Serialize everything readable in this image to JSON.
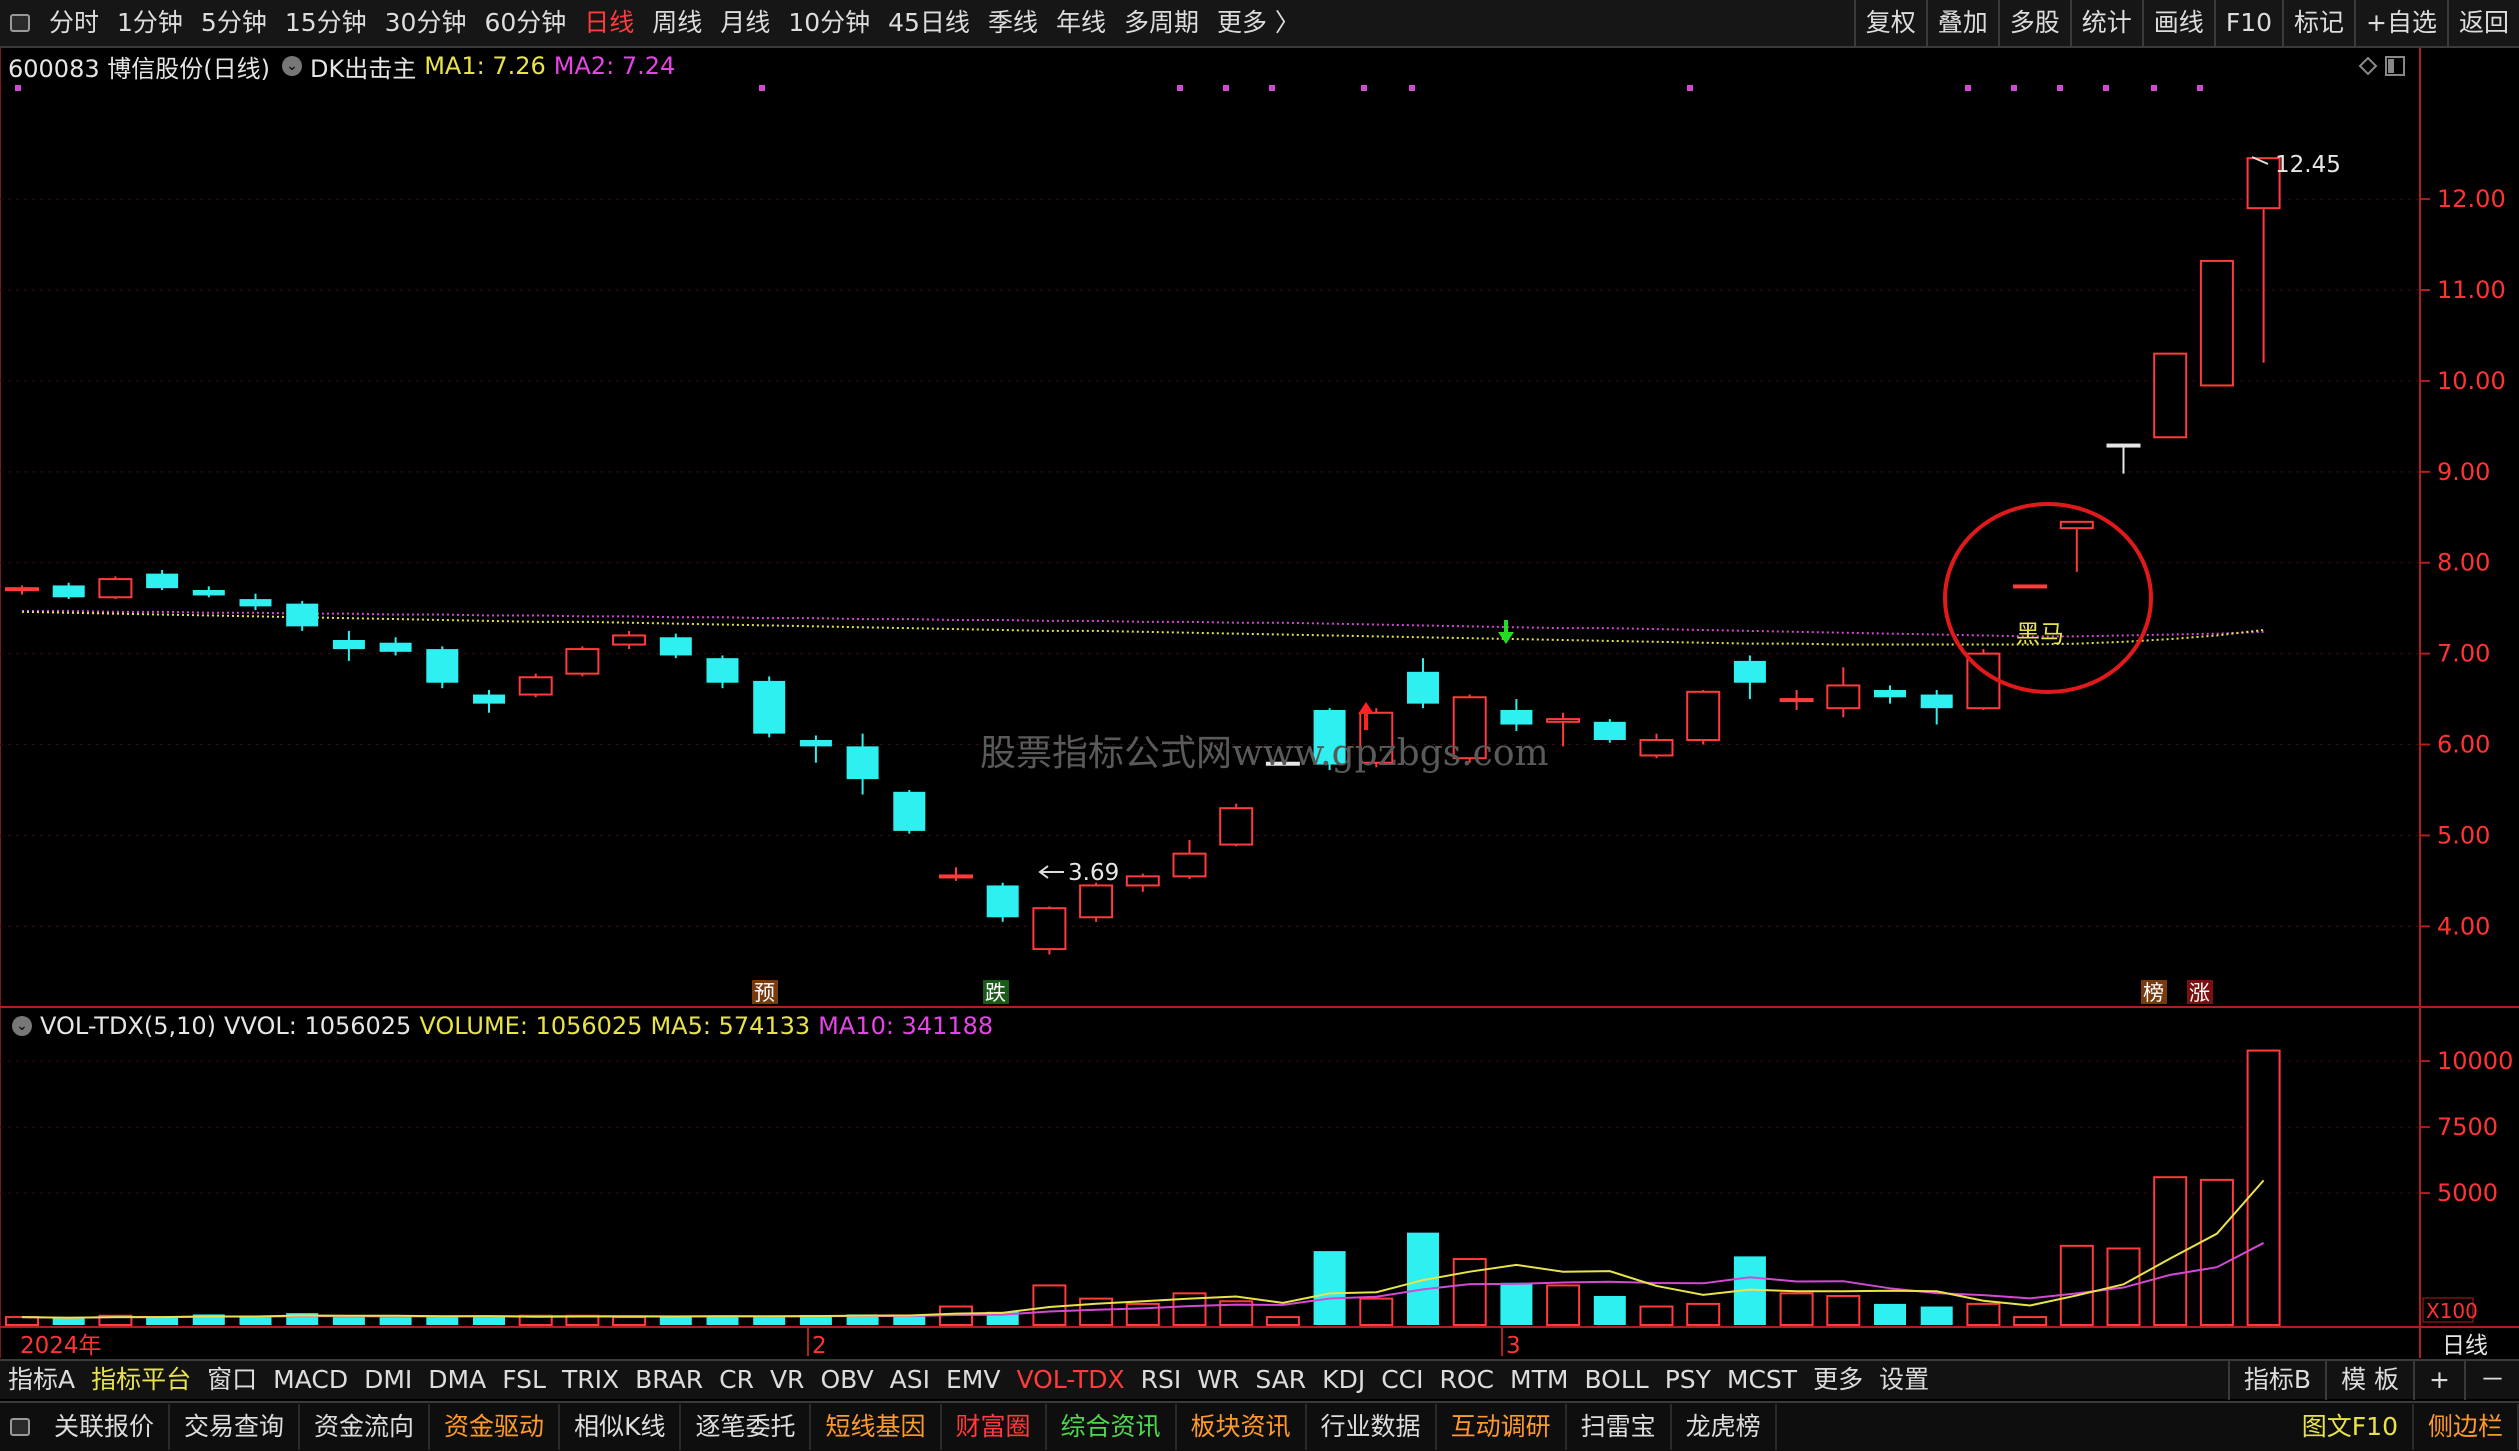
{
  "topbar": {
    "timeframes": [
      "分时",
      "1分钟",
      "5分钟",
      "15分钟",
      "30分钟",
      "60分钟",
      "日线",
      "周线",
      "月线",
      "10分钟",
      "45日线",
      "季线",
      "年线",
      "多周期",
      "更多 〉"
    ],
    "active_timeframe": "日线",
    "right_buttons": [
      "复权",
      "叠加",
      "多股",
      "统计",
      "画线",
      "F10",
      "标记",
      "+自选",
      "返回"
    ]
  },
  "stock": {
    "code_name": "600083 博信股份(日线)",
    "indicator": "DK出击主",
    "ma1": "MA1: 7.26",
    "ma2": "MA2: 7.24"
  },
  "price_axis": {
    "ticks": [
      "12.00",
      "11.00",
      "10.00",
      "9.00",
      "8.00",
      "7.00",
      "6.00",
      "5.00",
      "4.00"
    ]
  },
  "annotations": {
    "high_label": "12.45",
    "low_label": "3.69",
    "heima_label": "黑马",
    "watermark": "股票指标公式网www.gpzbgs.com",
    "marker_yu": "预",
    "marker_die": "跌",
    "marker_bang": "榜",
    "marker_zhang": "涨"
  },
  "volume": {
    "title": "VOL-TDX(5,10)",
    "vvol": "VVOL: 1056025",
    "volume": "VOLUME: 1056025",
    "ma5": "MA5: 574133",
    "ma10": "MA10: 341188",
    "ticks": [
      "10000",
      "7500",
      "5000"
    ],
    "unit": "X100"
  },
  "time_axis": {
    "year_label": "2024年",
    "month2": "2",
    "month3": "3",
    "period": "日线"
  },
  "chart_data": {
    "type": "candlestick",
    "title": "600083 博信股份(日线)",
    "ylim": [
      3.3,
      13.2
    ],
    "candles": [
      {
        "o": 7.7,
        "h": 7.75,
        "l": 7.65,
        "c": 7.72
      },
      {
        "o": 7.75,
        "h": 7.78,
        "l": 7.6,
        "c": 7.62
      },
      {
        "o": 7.62,
        "h": 7.85,
        "l": 7.6,
        "c": 7.82
      },
      {
        "o": 7.88,
        "h": 7.92,
        "l": 7.7,
        "c": 7.72
      },
      {
        "o": 7.7,
        "h": 7.74,
        "l": 7.62,
        "c": 7.64
      },
      {
        "o": 7.6,
        "h": 7.66,
        "l": 7.48,
        "c": 7.52
      },
      {
        "o": 7.55,
        "h": 7.58,
        "l": 7.25,
        "c": 7.3
      },
      {
        "o": 7.15,
        "h": 7.25,
        "l": 6.92,
        "c": 7.05
      },
      {
        "o": 7.12,
        "h": 7.18,
        "l": 6.98,
        "c": 7.02
      },
      {
        "o": 7.05,
        "h": 7.08,
        "l": 6.62,
        "c": 6.68
      },
      {
        "o": 6.55,
        "h": 6.6,
        "l": 6.35,
        "c": 6.45
      },
      {
        "o": 6.55,
        "h": 6.78,
        "l": 6.52,
        "c": 6.74
      },
      {
        "o": 6.78,
        "h": 7.08,
        "l": 6.75,
        "c": 7.05
      },
      {
        "o": 7.1,
        "h": 7.25,
        "l": 7.05,
        "c": 7.2
      },
      {
        "o": 7.18,
        "h": 7.22,
        "l": 6.95,
        "c": 6.98
      },
      {
        "o": 6.95,
        "h": 6.98,
        "l": 6.62,
        "c": 6.68
      },
      {
        "o": 6.7,
        "h": 6.75,
        "l": 6.08,
        "c": 6.12
      },
      {
        "o": 6.05,
        "h": 6.1,
        "l": 5.8,
        "c": 5.98
      },
      {
        "o": 5.98,
        "h": 6.12,
        "l": 5.45,
        "c": 5.62
      },
      {
        "o": 5.48,
        "h": 5.5,
        "l": 5.02,
        "c": 5.05
      },
      {
        "o": 4.55,
        "h": 4.65,
        "l": 4.5,
        "c": 4.56
      },
      {
        "o": 4.45,
        "h": 4.48,
        "l": 4.05,
        "c": 4.1
      },
      {
        "o": 3.75,
        "h": 4.22,
        "l": 3.69,
        "c": 4.2
      },
      {
        "o": 4.1,
        "h": 4.48,
        "l": 4.05,
        "c": 4.45
      },
      {
        "o": 4.45,
        "h": 4.58,
        "l": 4.38,
        "c": 4.55
      },
      {
        "o": 4.55,
        "h": 4.95,
        "l": 4.52,
        "c": 4.8
      },
      {
        "o": 4.9,
        "h": 5.35,
        "l": 4.88,
        "c": 5.3
      },
      {
        "o": 5.8,
        "h": 5.8,
        "l": 5.8,
        "c": 5.8
      },
      {
        "o": 6.38,
        "h": 6.4,
        "l": 5.72,
        "c": 5.78
      },
      {
        "o": 5.8,
        "h": 6.4,
        "l": 5.75,
        "c": 6.35
      },
      {
        "o": 6.8,
        "h": 6.95,
        "l": 6.4,
        "c": 6.45
      },
      {
        "o": 5.85,
        "h": 6.55,
        "l": 5.8,
        "c": 6.52
      },
      {
        "o": 6.38,
        "h": 6.5,
        "l": 6.15,
        "c": 6.22
      },
      {
        "o": 6.25,
        "h": 6.35,
        "l": 5.98,
        "c": 6.28
      },
      {
        "o": 6.25,
        "h": 6.28,
        "l": 6.02,
        "c": 6.05
      },
      {
        "o": 5.88,
        "h": 6.12,
        "l": 5.85,
        "c": 6.05
      },
      {
        "o": 6.05,
        "h": 6.6,
        "l": 6.0,
        "c": 6.58
      },
      {
        "o": 6.92,
        "h": 6.98,
        "l": 6.5,
        "c": 6.68
      },
      {
        "o": 6.48,
        "h": 6.6,
        "l": 6.38,
        "c": 6.5
      },
      {
        "o": 6.4,
        "h": 6.85,
        "l": 6.3,
        "c": 6.65
      },
      {
        "o": 6.6,
        "h": 6.65,
        "l": 6.45,
        "c": 6.52
      },
      {
        "o": 6.55,
        "h": 6.6,
        "l": 6.22,
        "c": 6.4
      },
      {
        "o": 6.4,
        "h": 7.05,
        "l": 6.38,
        "c": 7.0
      },
      {
        "o": 7.75,
        "h": 7.75,
        "l": 7.75,
        "c": 7.75
      },
      {
        "o": 8.38,
        "h": 8.45,
        "l": 7.9,
        "c": 8.45
      },
      {
        "o": 9.3,
        "h": 9.3,
        "l": 8.98,
        "c": 9.3
      },
      {
        "o": 9.38,
        "h": 10.3,
        "l": 9.38,
        "c": 10.3
      },
      {
        "o": 9.95,
        "h": 11.32,
        "l": 9.95,
        "c": 11.32
      },
      {
        "o": 11.9,
        "h": 12.45,
        "l": 10.2,
        "c": 12.45
      }
    ],
    "ma_yellow": [
      7.46,
      7.45,
      7.44,
      7.43,
      7.42,
      7.41,
      7.4,
      7.39,
      7.38,
      7.37,
      7.36,
      7.35,
      7.35,
      7.34,
      7.33,
      7.32,
      7.31,
      7.3,
      7.29,
      7.28,
      7.27,
      7.26,
      7.25,
      7.25,
      7.24,
      7.23,
      7.22,
      7.21,
      7.2,
      7.19,
      7.18,
      7.17,
      7.16,
      7.15,
      7.14,
      7.13,
      7.12,
      7.11,
      7.11,
      7.1,
      7.1,
      7.1,
      7.1,
      7.1,
      7.11,
      7.13,
      7.16,
      7.2,
      7.26
    ],
    "ma_magenta": [
      7.47,
      7.47,
      7.46,
      7.46,
      7.45,
      7.45,
      7.44,
      7.44,
      7.43,
      7.43,
      7.42,
      7.42,
      7.41,
      7.41,
      7.4,
      7.4,
      7.39,
      7.39,
      7.38,
      7.38,
      7.37,
      7.37,
      7.36,
      7.36,
      7.35,
      7.35,
      7.34,
      7.34,
      7.33,
      7.32,
      7.31,
      7.3,
      7.29,
      7.28,
      7.28,
      7.27,
      7.26,
      7.25,
      7.24,
      7.23,
      7.22,
      7.21,
      7.2,
      7.19,
      7.19,
      7.2,
      7.21,
      7.22,
      7.24
    ],
    "volumes": [
      300,
      250,
      350,
      300,
      400,
      300,
      450,
      300,
      300,
      300,
      320,
      350,
      350,
      300,
      300,
      350,
      350,
      380,
      400,
      320,
      700,
      500,
      1500,
      1000,
      800,
      1200,
      900,
      300,
      2800,
      1000,
      3500,
      2500,
      1600,
      1500,
      1100,
      700,
      800,
      2600,
      1200,
      1100,
      800,
      700,
      800,
      300,
      3000,
      2900,
      5600,
      5500,
      10400
    ],
    "vol_ylim": [
      0,
      10800
    ]
  }
}
